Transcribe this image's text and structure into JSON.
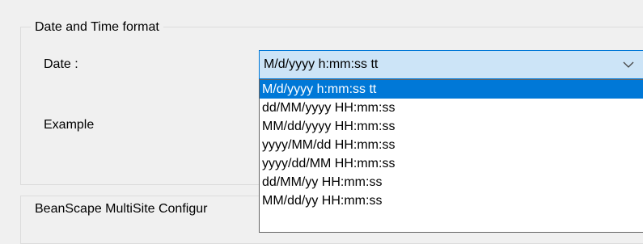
{
  "date_time_group": {
    "title": "Date and Time format",
    "date_label": "Date :",
    "example_label": "Example",
    "date_combo": {
      "selected_value": "M/d/yyyy h:mm:ss tt",
      "options": [
        "M/d/yyyy h:mm:ss tt",
        "dd/MM/yyyy HH:mm:ss",
        "MM/dd/yyyy HH:mm:ss",
        "yyyy/MM/dd HH:mm:ss",
        "yyyy/dd/MM HH:mm:ss",
        "dd/MM/yy HH:mm:ss",
        "MM/dd/yy HH:mm:ss"
      ],
      "highlighted_index": 0
    }
  },
  "multisite_group": {
    "title": "BeanScape MultiSite Configur"
  },
  "icons": {
    "combo_arrow": "chevron-down-icon"
  },
  "colors": {
    "window_bg": "#f0f0f0",
    "combo_bg": "#cce4f7",
    "combo_border": "#0078d7",
    "selection_bg": "#0078d7",
    "selection_text": "#ffffff",
    "group_border": "#dcdcdc"
  }
}
